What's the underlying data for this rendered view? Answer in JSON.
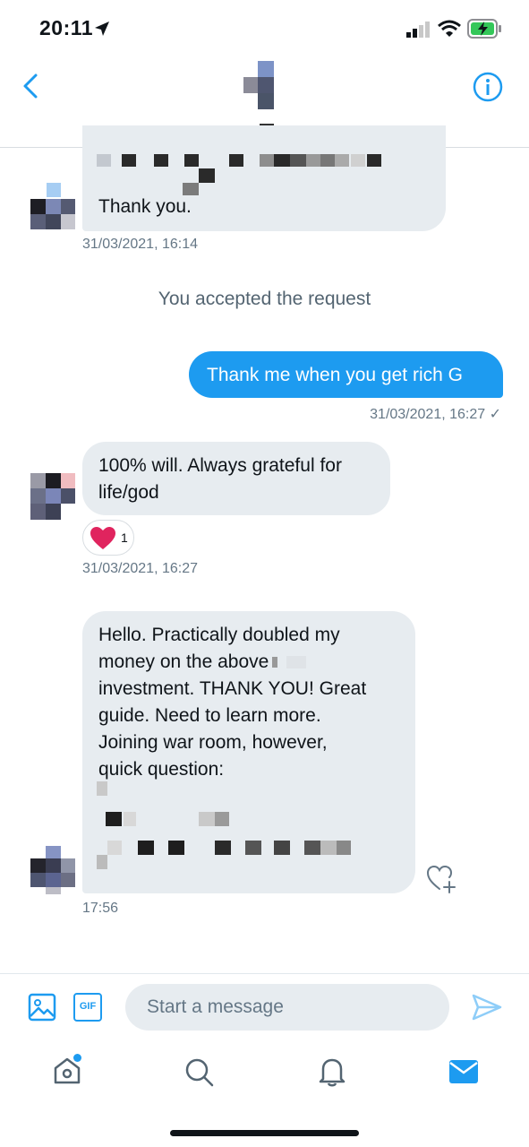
{
  "status_bar": {
    "time": "20:11"
  },
  "conversation": {
    "messages": [
      {
        "id": "m1",
        "direction": "incoming",
        "text": "Thank you.",
        "timestamp": "31/03/2021, 16:14"
      },
      {
        "id": "sys1",
        "direction": "system",
        "text": "You accepted the request"
      },
      {
        "id": "m2",
        "direction": "outgoing",
        "text": "Thank me when you get rich G",
        "timestamp": "31/03/2021, 16:27 ✓"
      },
      {
        "id": "m3",
        "direction": "incoming",
        "text_lines": [
          "100% will. Always grateful for",
          "life/god"
        ],
        "reaction": {
          "emoji": "heart",
          "count": "1"
        },
        "timestamp": "31/03/2021, 16:27"
      },
      {
        "id": "m4",
        "direction": "incoming",
        "text_lines": [
          "Hello. Practically doubled my",
          "money on the above",
          "investment. THANK YOU!  Great",
          "guide. Need to learn more.",
          "Joining war room, however,",
          "quick question:"
        ],
        "timestamp": "17:56"
      }
    ]
  },
  "composer": {
    "placeholder": "Start a message",
    "gif_label": "GIF"
  },
  "colors": {
    "accent": "#1d9bf0",
    "bubble_incoming": "#e7ecf0",
    "heart": "#e0245e",
    "text_secondary": "#657786"
  },
  "icons": [
    "back-arrow-icon",
    "info-icon",
    "image-icon",
    "gif-icon",
    "send-icon",
    "home-icon",
    "search-icon",
    "bell-icon",
    "mail-icon",
    "heart-plus-icon",
    "location-arrow-icon",
    "signal-icon",
    "wifi-icon",
    "battery-charging-icon"
  ]
}
